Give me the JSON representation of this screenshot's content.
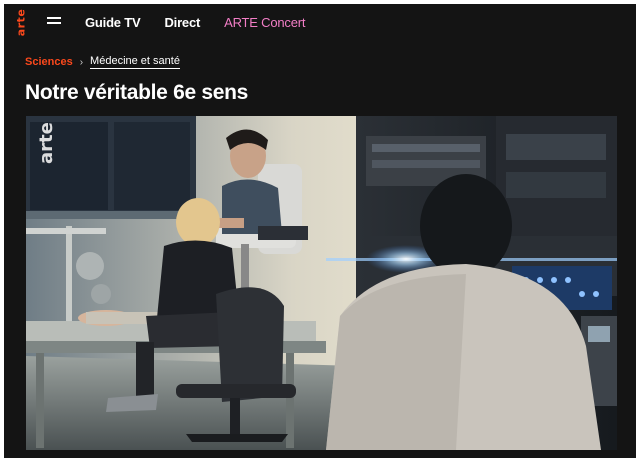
{
  "header": {
    "logo_text": "arte",
    "menu_icon": "hamburger-menu-icon",
    "nav": [
      {
        "label": "Guide TV"
      },
      {
        "label": "Direct"
      },
      {
        "label": "ARTE Concert",
        "color": "#f27ec6"
      }
    ]
  },
  "breadcrumb": {
    "category": "Sciences",
    "separator": "›",
    "subcategory": "Médecine et santé"
  },
  "program": {
    "title": "Notre véritable 6e sens",
    "image": {
      "watermark": "arte",
      "description_icon": "lab-scene-image"
    }
  },
  "colors": {
    "background": "#141414",
    "brand_orange": "#fa481c",
    "concert_pink": "#f27ec6"
  }
}
